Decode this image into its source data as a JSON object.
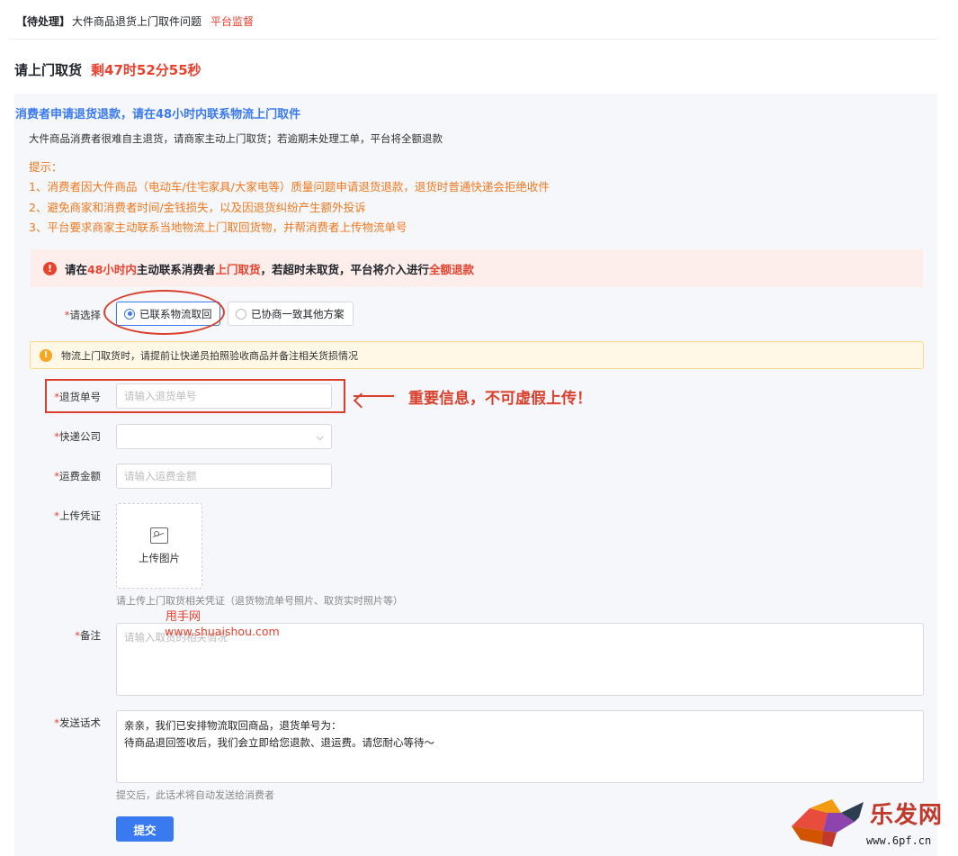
{
  "topbar": {
    "status": "【待处理】",
    "title": "大件商品退货上门取件问题",
    "platform": "平台监督"
  },
  "heading": {
    "title": "请上门取货",
    "countdown": "剩47时52分55秒"
  },
  "notice": {
    "primary": "消费者申请退货退款，请在48小时内联系物流上门取件",
    "secondary": "大件商品消费者很难自主退货，请商家主动上门取货；若逾期未处理工单，平台将全额退款",
    "tips_title": "提示：",
    "tips": [
      "1、消费者因大件商品（电动车/住宅家具/大家电等）质量问题申请退货退款，退货时普通快递会拒绝收件",
      "2、避免商家和消费者时间/金钱损失，以及因退货纠纷产生额外投诉",
      "3、平台要求商家主动联系当地物流上门取回货物，并帮消费者上传物流单号"
    ]
  },
  "alert": {
    "icon": "exclamation-icon",
    "p1": "请在",
    "p2": "48小时内",
    "p3": "主动联系消费者",
    "p4": "上门取货",
    "p5": "，若超时未取货，平台将介入进行",
    "p6": "全额退款"
  },
  "form": {
    "choose_label": "请选择",
    "option1": "已联系物流取回",
    "option2": "已协商一致其他方案",
    "warn": "物流上门取货时，请提前让快递员拍照验收商品并备注相关货损情况",
    "tracking_label": "退货单号",
    "tracking_placeholder": "请输入退货单号",
    "courier_label": "快递公司",
    "fee_label": "运费金额",
    "fee_placeholder": "请输入运费金额",
    "proof_label": "上传凭证",
    "upload_text": "上传图片",
    "proof_hint": "请上传上门取货相关凭证（退货物流单号照片、取货实时照片等）",
    "remark_label": "备注",
    "remark_placeholder": "请输入取货的相关情况",
    "message_label": "发送话术",
    "message_line1": "亲亲，我们已安排物流取回商品，退货单号为：",
    "message_line2": "待商品退回签收后，我们会立即给您退款、退运费。请您耐心等待～",
    "message_hint": "提交后，此话术将自动发送给消费者",
    "submit": "提交"
  },
  "annotation": {
    "text": "重要信息，不可虚假上传！"
  },
  "watermark": {
    "line1": "甩手网",
    "line2": "www.shuaishou.com"
  },
  "logo": {
    "brand": "乐发网",
    "url": "www.6pf.cn"
  },
  "colors": {
    "accent": "#3a7af0",
    "danger": "#e8412e",
    "tips": "#f0781e"
  }
}
